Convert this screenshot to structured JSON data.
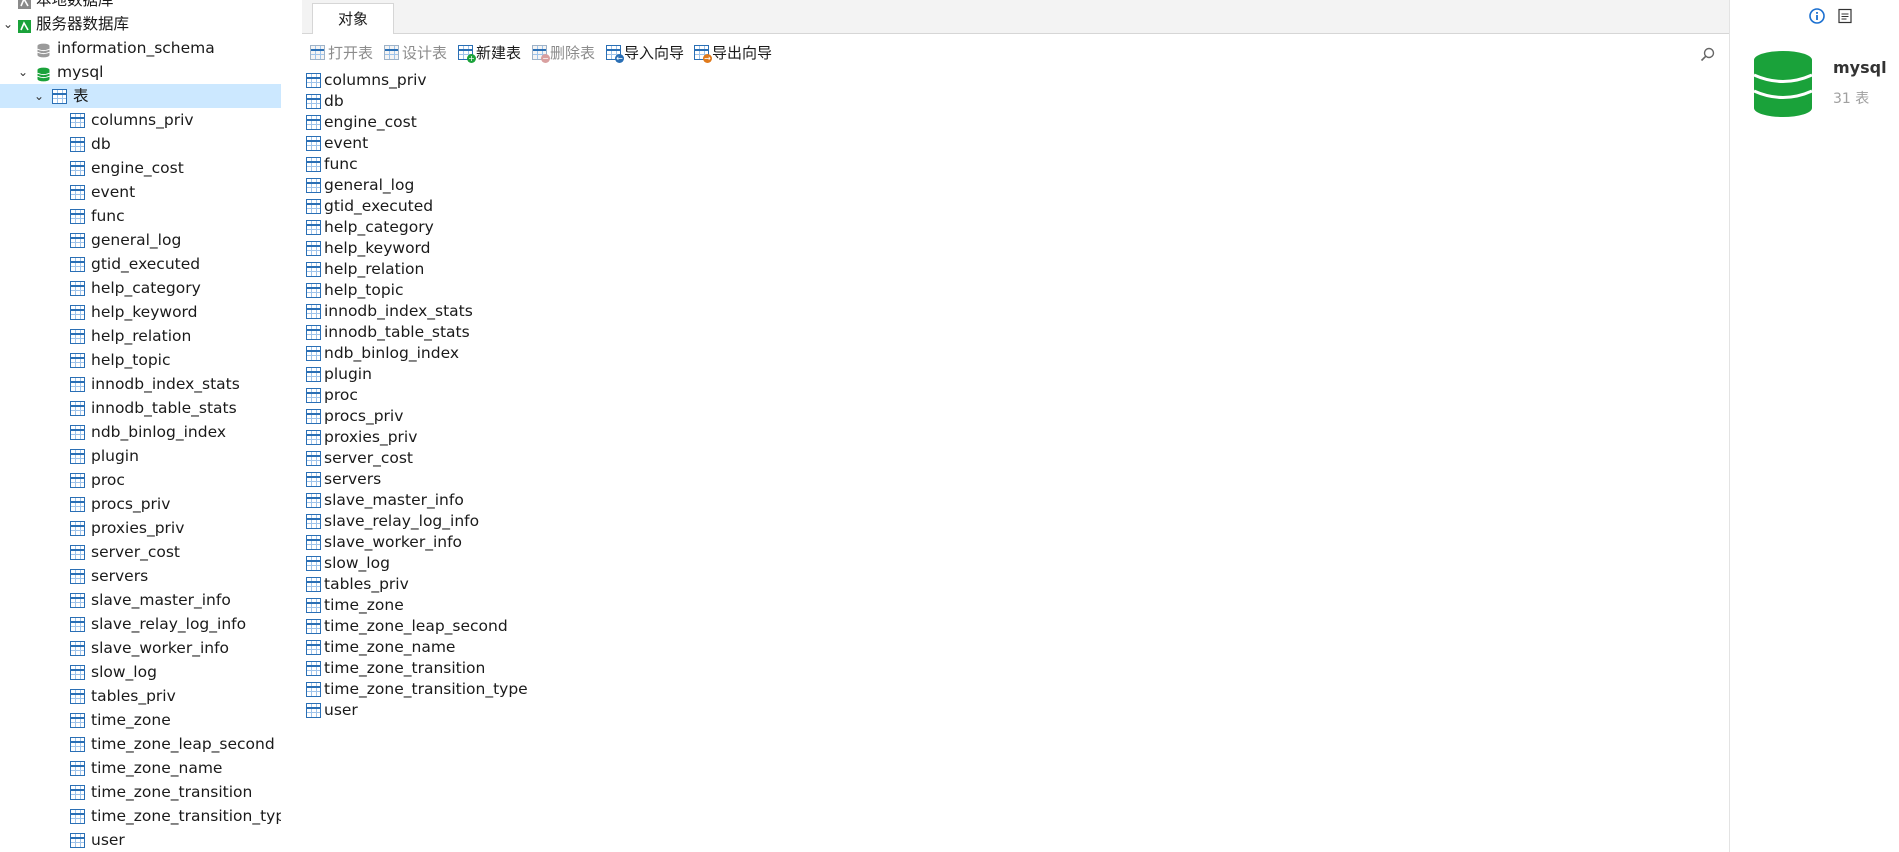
{
  "sidebar": {
    "connections": [
      {
        "label": "本地数据库"
      },
      {
        "label": "服务器数据库"
      }
    ],
    "databases": [
      {
        "label": "information_schema"
      },
      {
        "label": "mysql"
      }
    ],
    "tables_node": {
      "label": "表"
    },
    "tables": [
      "columns_priv",
      "db",
      "engine_cost",
      "event",
      "func",
      "general_log",
      "gtid_executed",
      "help_category",
      "help_keyword",
      "help_relation",
      "help_topic",
      "innodb_index_stats",
      "innodb_table_stats",
      "ndb_binlog_index",
      "plugin",
      "proc",
      "procs_priv",
      "proxies_priv",
      "server_cost",
      "servers",
      "slave_master_info",
      "slave_relay_log_info",
      "slave_worker_info",
      "slow_log",
      "tables_priv",
      "time_zone",
      "time_zone_leap_second",
      "time_zone_name",
      "time_zone_transition",
      "time_zone_transition_type",
      "user"
    ]
  },
  "tabs": [
    {
      "label": "对象"
    }
  ],
  "toolbar": {
    "open_table": "打开表",
    "design_table": "设计表",
    "new_table": "新建表",
    "delete_table": "删除表",
    "import_wizard": "导入向导",
    "export_wizard": "导出向导"
  },
  "objects": [
    "columns_priv",
    "db",
    "engine_cost",
    "event",
    "func",
    "general_log",
    "gtid_executed",
    "help_category",
    "help_keyword",
    "help_relation",
    "help_topic",
    "innodb_index_stats",
    "innodb_table_stats",
    "ndb_binlog_index",
    "plugin",
    "proc",
    "procs_priv",
    "proxies_priv",
    "server_cost",
    "servers",
    "slave_master_info",
    "slave_relay_log_info",
    "slave_worker_info",
    "slow_log",
    "tables_priv",
    "time_zone",
    "time_zone_leap_second",
    "time_zone_name",
    "time_zone_transition",
    "time_zone_transition_type",
    "user"
  ],
  "info_panel": {
    "db_name": "mysql",
    "table_count": "31 表"
  },
  "colors": {
    "selection": "#cce8ff",
    "db_green": "#1aa23a",
    "table_blue": "#2a6fb5"
  },
  "icons": {
    "connection": "connection-icon",
    "database": "database-icon",
    "table": "table-icon",
    "search": "search-icon",
    "info": "info-icon",
    "ddl": "ddl-icon"
  }
}
